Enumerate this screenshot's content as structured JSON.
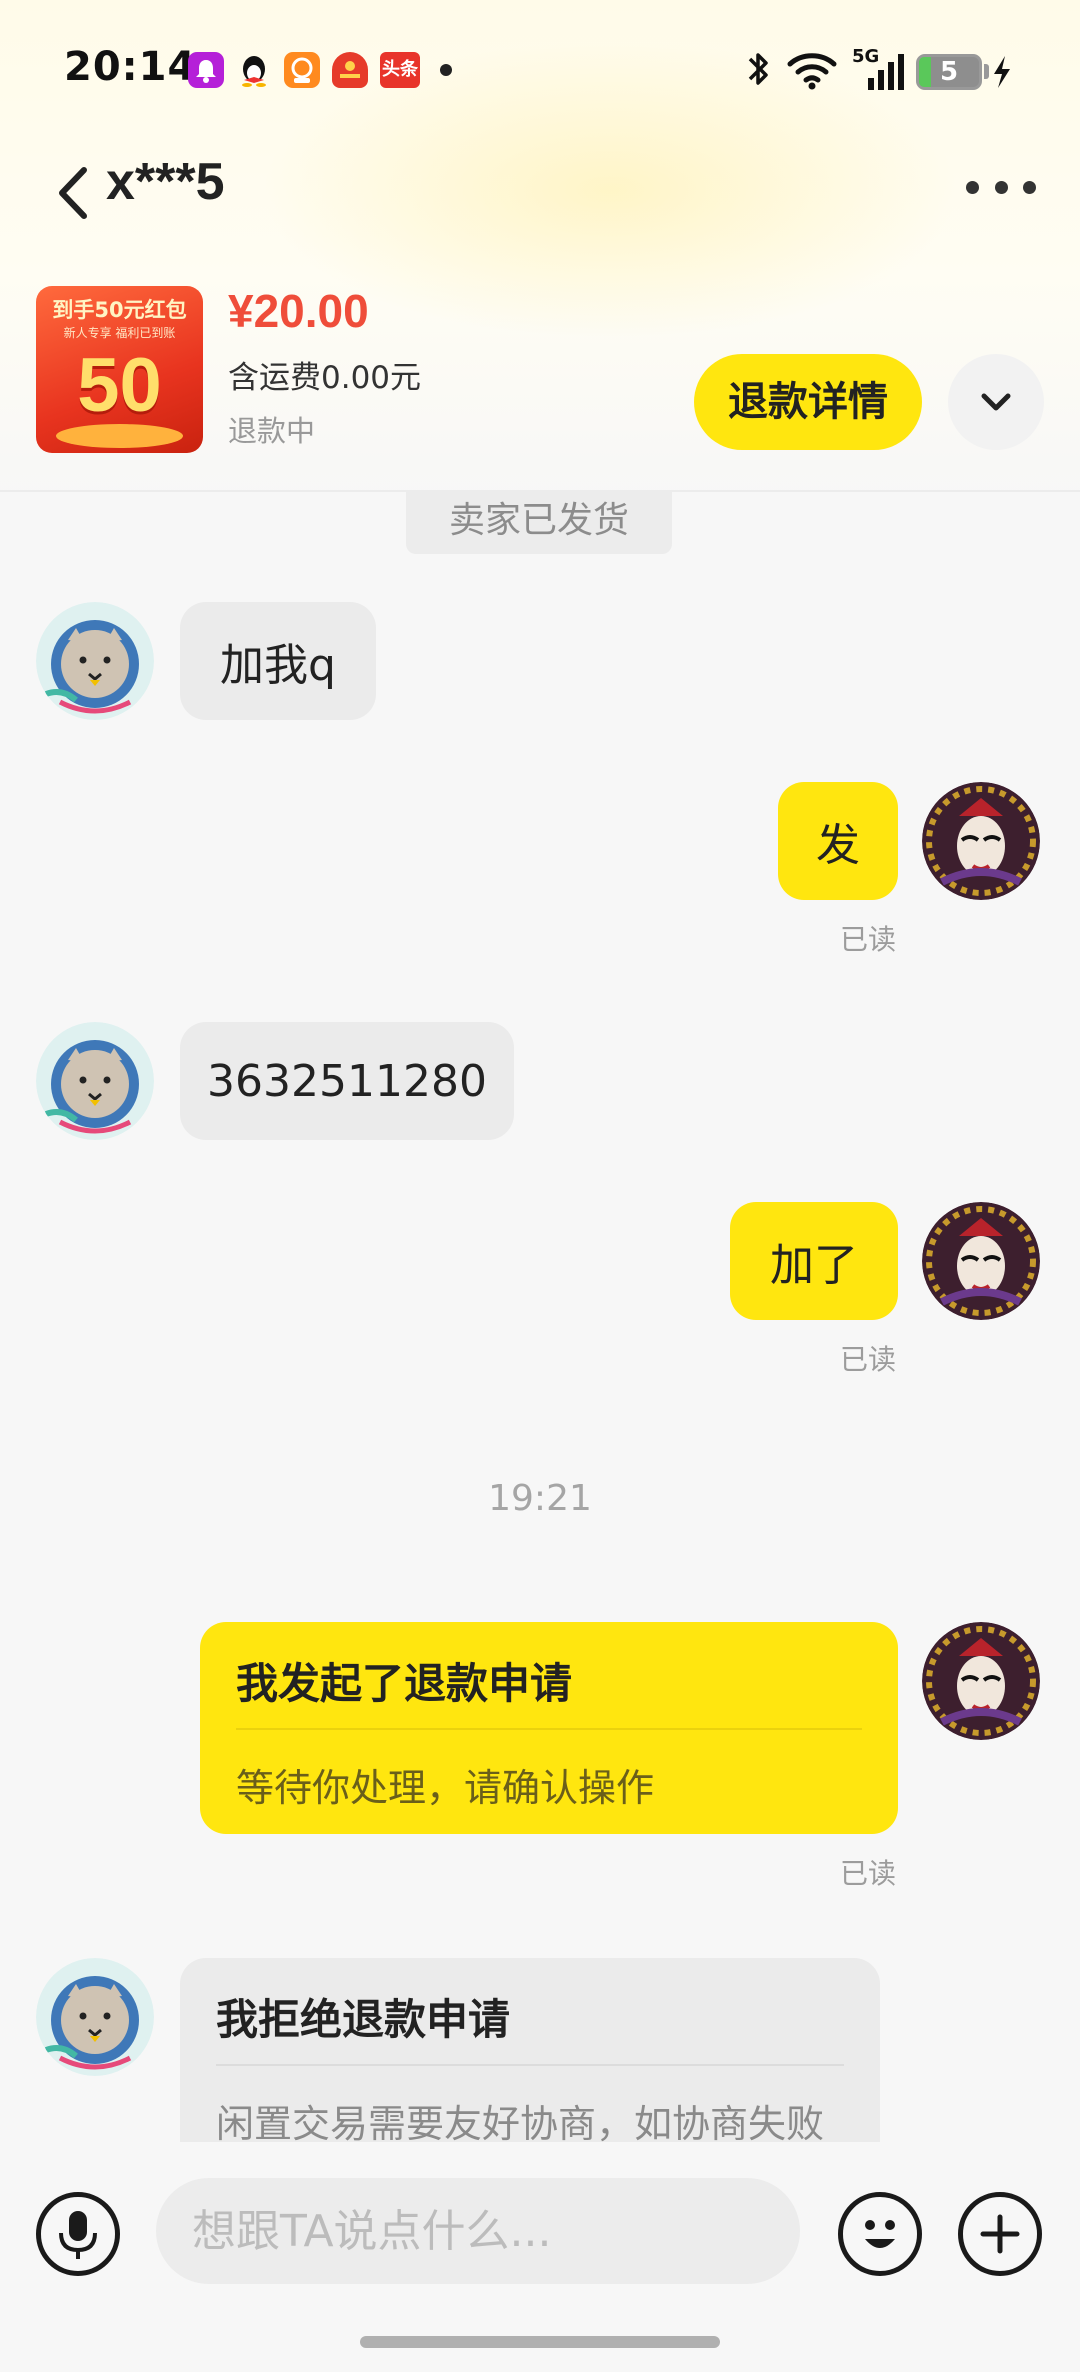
{
  "status_bar": {
    "time": "20:14",
    "network": "5G",
    "battery_level": "5",
    "notification_icons": [
      "bell-app-icon",
      "qq-penguin-icon",
      "video-app-icon",
      "red-app-icon",
      "toutiao-icon"
    ],
    "toutiao_label": "头条"
  },
  "header": {
    "title": "x***5",
    "back_icon": "chevron-left-icon",
    "more_icon": "more-dots-icon"
  },
  "product": {
    "thumb_title": "到手50元红包",
    "thumb_sub": "新人专享 福利已到账",
    "thumb_big": "50",
    "price": "¥20.00",
    "shipping": "含运费0.00元",
    "status": "退款中",
    "refund_button": "退款详情",
    "expand_icon": "chevron-down-icon"
  },
  "system_label": "卖家已发货",
  "messages": [
    {
      "side": "left",
      "text": "加我q"
    },
    {
      "side": "right",
      "text": "发",
      "read": "已读"
    },
    {
      "side": "left",
      "text": "3632511280"
    },
    {
      "side": "right",
      "text": "加了",
      "read": "已读"
    }
  ],
  "timestamp": "19:21",
  "cards": [
    {
      "side": "right",
      "title": "我发起了退款申请",
      "text": "等待你处理，请确认操作",
      "read": "已读"
    },
    {
      "side": "left",
      "title": "我拒绝退款申请",
      "text": "闲置交易需要友好协商，如协商失败可申请客服介入"
    }
  ],
  "input_bar": {
    "placeholder": "想跟TA说点什么...",
    "voice_icon": "microphone-icon",
    "emoji_icon": "emoji-icon",
    "plus_icon": "plus-icon"
  },
  "colors": {
    "accent": "#ffe60f",
    "price": "#ef4d3a",
    "left_bubble": "#ebebeb"
  }
}
